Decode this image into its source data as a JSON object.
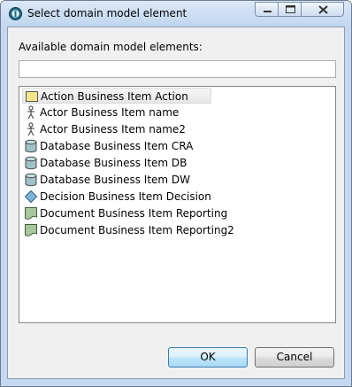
{
  "window": {
    "title": "Select domain model element"
  },
  "dialog": {
    "list_label": "Available domain model elements:",
    "filter": {
      "value": "",
      "placeholder": ""
    },
    "items": [
      {
        "label": "Action Business Item Action",
        "icon": "action-icon",
        "selected": true
      },
      {
        "label": "Actor Business Item name",
        "icon": "actor-icon",
        "selected": false
      },
      {
        "label": "Actor Business Item name2",
        "icon": "actor-icon",
        "selected": false
      },
      {
        "label": "Database Business Item CRA",
        "icon": "database-icon",
        "selected": false
      },
      {
        "label": "Database Business Item DB",
        "icon": "database-icon",
        "selected": false
      },
      {
        "label": "Database Business Item DW",
        "icon": "database-icon",
        "selected": false
      },
      {
        "label": "Decision Business Item Decision",
        "icon": "decision-icon",
        "selected": false
      },
      {
        "label": "Document Business Item Reporting",
        "icon": "document-icon",
        "selected": false
      },
      {
        "label": "Document Business Item Reporting2",
        "icon": "document-icon",
        "selected": false
      }
    ],
    "ok_label": "OK",
    "cancel_label": "Cancel"
  },
  "colors": {
    "action": "#f2e68a",
    "database": "#9fc2c7",
    "decision": "#7fb4d9",
    "document": "#a9c79f"
  }
}
